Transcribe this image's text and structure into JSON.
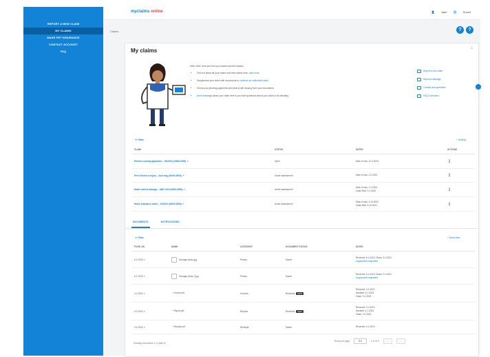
{
  "sidebar": {
    "items": [
      {
        "label": "REPORT A NEW CLAIM",
        "active": false
      },
      {
        "label": "MY CLAIMS",
        "active": true
      },
      {
        "label": "MAKE PET INSURANCE",
        "active": false
      },
      {
        "label": "CONTACT ACCOUNT",
        "active": false
      },
      {
        "label": "FAQ",
        "active": false
      }
    ]
  },
  "topbar": {
    "logo_main": "myclaims",
    "logo_accent": "online",
    "user": "Jane",
    "lang": "Suomi"
  },
  "breadcrumb": "Claims",
  "main": {
    "title": "My claims",
    "intro": "Hello Jane, here you find your claims and their status.",
    "bullets": [
      {
        "text": "Find out about all your claims and their status here:",
        "link": "read more"
      },
      {
        "text": "Supplement your claim with documents or ",
        "link": "continue an unfinished claim"
      },
      {
        "text": "Check your pending payments and what is still missing from your documents",
        "link": ""
      },
      {
        "text": "",
        "link": "Send message",
        "rest": " about your claim here if you have questions about your claim or its handling."
      }
    ],
    "side_links": [
      "Report a new claim",
      "Report a damage",
      "Contact and questions",
      "FAQ & services"
    ]
  },
  "claims": {
    "filter_label": "Filter",
    "sort_label": "Sorting",
    "columns": [
      "CLAIM",
      "STATUS",
      "DATES",
      "ACTIONS"
    ],
    "rows": [
      {
        "claim": "Electric cooking appliance – 03/2023 (#0000-0000) ↗",
        "status": "Open",
        "dates": [
          "Date of loss: 12.3.2023"
        ]
      },
      {
        "claim": "Pet's illness or injury – Axel dog (#0000-0000) ↗",
        "status": "Under assessment",
        "dates": [
          "Date of loss: 2.2.2023"
        ]
      },
      {
        "claim": "Motor vehicle damage – ABC-123 (#0000-0000) ↗",
        "status": "Under assessment",
        "dates": [
          "Date of loss: 1.1.2023",
          "Claim filed: 3.1.2023"
        ]
      },
      {
        "claim": "Home insurance claim – 10/2022 (#0000-0000) ↗",
        "status": "Under assessment",
        "dates": [
          "Date of loss: 4.10.2022",
          "Claim filed: 6.10.2022"
        ]
      }
    ]
  },
  "tabs": [
    "DOCUMENTS",
    "NOTIFICATIONS"
  ],
  "docs": {
    "filter_label": "Filter",
    "new_label": "+ Send files",
    "columns": [
      "FILED ON",
      "NAME",
      "CATEGORY",
      "DOCUMENT STATUS",
      "DATES"
    ],
    "rows": [
      {
        "date": "6.1.2023",
        "name": "Damage photo.jpg",
        "cat": "Photos",
        "status": "Saved",
        "badge": "",
        "dates": [
          "Received: 6.1.2023, Claim: 3.1.2023",
          "Supplement requested"
        ]
      },
      {
        "date": "6.1.2023",
        "name": "Damage photo 2.jpg",
        "cat": "Photos",
        "status": "Saved",
        "badge": "",
        "dates": [
          "Received: 6.1.2023, Claim: 3.1.2023",
          "Supplement requested"
        ]
      },
      {
        "date": "4.1.2023",
        "name": "Invoice.pdf",
        "cat": "Invoices",
        "status": "Received",
        "badge": "NEW",
        "dates": [
          "Received: 4.1.2023",
          "Handled: 5.1.2023",
          "Claim: 3.1.2023"
        ]
      },
      {
        "date": "3.1.2023",
        "name": "Report.pdf",
        "cat": "Reports",
        "status": "Received",
        "badge": "NEW",
        "dates": [
          "Received: 3.1.2023",
          "Handled: 4.1.2023",
          "Claim: 3.1.2023"
        ]
      },
      {
        "date": "3.1.2023",
        "name": "Receipt.pdf",
        "cat": "Receipts",
        "status": "Saved",
        "badge": "",
        "dates": [
          "Received: 3.1.2023"
        ]
      }
    ]
  },
  "footer": {
    "count": "Showing documents 1–5 (total 5)",
    "rows_label": "Rows per page",
    "rows_value": "5",
    "page_info": "1–5 of 5",
    "prev": "‹",
    "next": "›"
  }
}
